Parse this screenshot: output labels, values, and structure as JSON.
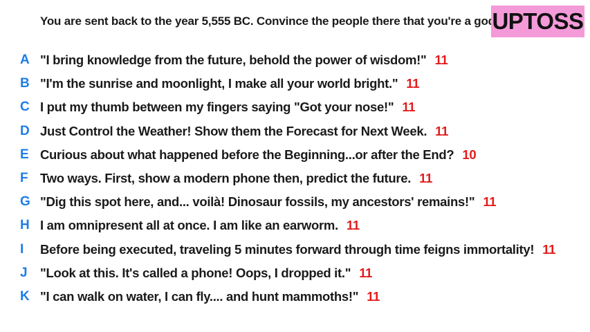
{
  "prompt": "You are sent back to the year 5,555 BC. Convince the people there that you're a god.",
  "logo": {
    "text": "UPTOSS",
    "background": "#f49ad9"
  },
  "colors": {
    "letter": "#1e7de6",
    "score": "#e31b1b"
  },
  "answers": [
    {
      "letter": "A",
      "text": "\"I bring knowledge from the future, behold the power of wisdom!\"",
      "score": "11"
    },
    {
      "letter": "B",
      "text": "\"I'm the sunrise and moonlight, I make all your world bright.\"",
      "score": "11"
    },
    {
      "letter": "C",
      "text": "I put my thumb between my fingers saying \"Got your nose!\"",
      "score": "11"
    },
    {
      "letter": "D",
      "text": "Just Control the Weather! Show them the Forecast for Next Week.",
      "score": "11"
    },
    {
      "letter": "E",
      "text": "Curious about what happened before the Beginning...or after the End?",
      "score": "10"
    },
    {
      "letter": "F",
      "text": "Two ways. First, show a modern phone then, predict the future.",
      "score": "11"
    },
    {
      "letter": "G",
      "text": "\"Dig this spot here, and... voilà! Dinosaur fossils, my ancestors' remains!\"",
      "score": "11"
    },
    {
      "letter": "H",
      "text": "I am omnipresent all at once. I am like an earworm.",
      "score": "11"
    },
    {
      "letter": "I",
      "text": "Before being executed, traveling 5 minutes forward through time feigns immortality!",
      "score": "11"
    },
    {
      "letter": "J",
      "text": "\"Look at this. It's called a phone! Oops, I dropped it.\"",
      "score": "11"
    },
    {
      "letter": "K",
      "text": "\"I can walk on water, I can fly.... and hunt mammoths!\"",
      "score": "11"
    }
  ]
}
